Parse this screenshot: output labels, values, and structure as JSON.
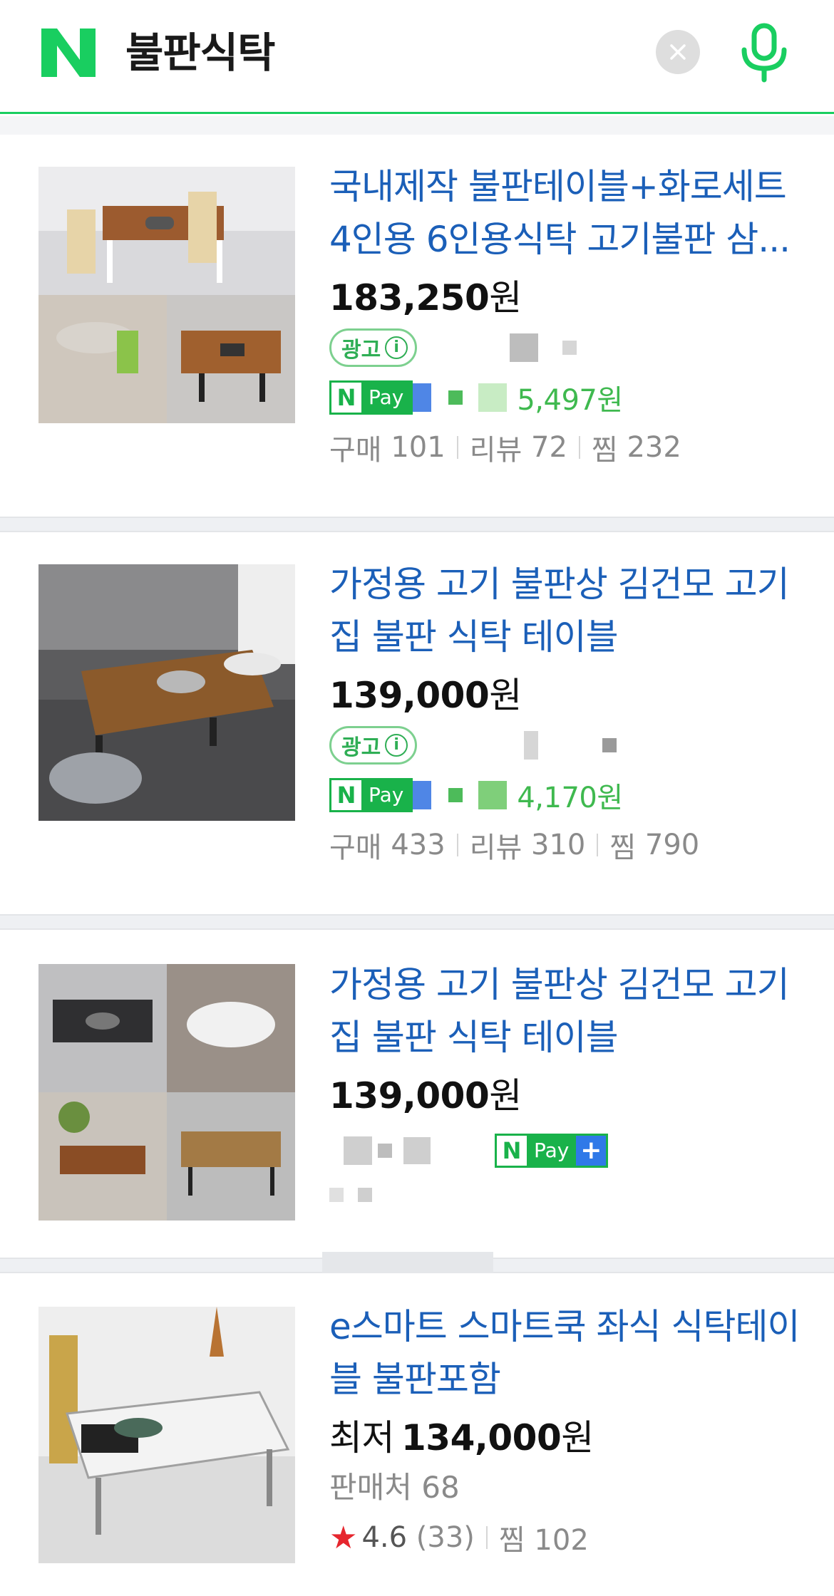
{
  "header": {
    "query": "불판식탁",
    "logo": "N",
    "clear_icon": "close-icon",
    "mic_icon": "microphone-icon",
    "accent_color": "#19ce60"
  },
  "products": [
    {
      "title": "국내제작 불판테이블+화로세트 4인용 6인용식탁 고기불판 삼...",
      "price": "183,250",
      "currency": "원",
      "ad_label": "광고",
      "npay": {
        "n": "N",
        "pay": "Pay"
      },
      "points": "5,497원",
      "stats": [
        {
          "label": "구매",
          "value": "101"
        },
        {
          "label": "리뷰",
          "value": "72"
        },
        {
          "label": "찜",
          "value": "232"
        }
      ]
    },
    {
      "title": "가정용 고기 불판상 김건모 고기집 불판 식탁 테이블",
      "price": "139,000",
      "currency": "원",
      "ad_label": "광고",
      "npay": {
        "n": "N",
        "pay": "Pay"
      },
      "points": "4,170원",
      "stats": [
        {
          "label": "구매",
          "value": "433"
        },
        {
          "label": "리뷰",
          "value": "310"
        },
        {
          "label": "찜",
          "value": "790"
        }
      ]
    },
    {
      "title": "가정용 고기 불판상 김건모 고기집 불판 식탁 테이블",
      "price": "139,000",
      "currency": "원",
      "npay": {
        "n": "N",
        "pay": "Pay",
        "plus": "+"
      }
    },
    {
      "title": "e스마트 스마트쿡 좌식 식탁테이블 불판포함",
      "price_prefix": "최저",
      "price": "134,000",
      "currency": "원",
      "sellers": "판매처 68",
      "rating": "4.6",
      "review_count": "(33)",
      "zzim": "찜 102"
    }
  ]
}
